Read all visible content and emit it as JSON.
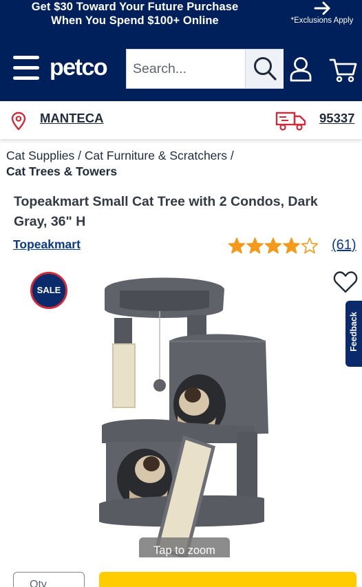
{
  "promo": {
    "line1": "Get $30 Toward Your Future Purchase",
    "line2": "When You Spend $100+ Online",
    "exclusions": "*Exclusions Apply"
  },
  "header": {
    "logo": "petco",
    "search_placeholder": "Search...",
    "colors": {
      "navy": "#00205b",
      "link": "#0b3a86",
      "cta": "#ffcc00",
      "sale_ring": "#d12b3a"
    }
  },
  "location": {
    "store": "MANTECA",
    "zip": "95337"
  },
  "breadcrumb": {
    "item1": "Cat Supplies",
    "item2": "Cat Furniture & Scratchers",
    "separator": " / ",
    "current": "Cat Trees & Towers"
  },
  "product": {
    "title": "Topeakmart Small Cat Tree with 2 Condos, Dark Gray, 36\" H",
    "brand": "Topeakmart",
    "rating": 4,
    "rating_max": 5,
    "review_count": "(61)",
    "badge": "SALE",
    "zoom_hint": "Tap to zoom"
  },
  "feedback_tab": "Feedback",
  "purchase": {
    "qty_label": "Qty"
  },
  "icons": [
    "menu-icon",
    "search-icon",
    "account-icon",
    "cart-icon",
    "location-pin-icon",
    "delivery-truck-icon",
    "arrow-right-icon",
    "star-icon",
    "heart-icon"
  ]
}
